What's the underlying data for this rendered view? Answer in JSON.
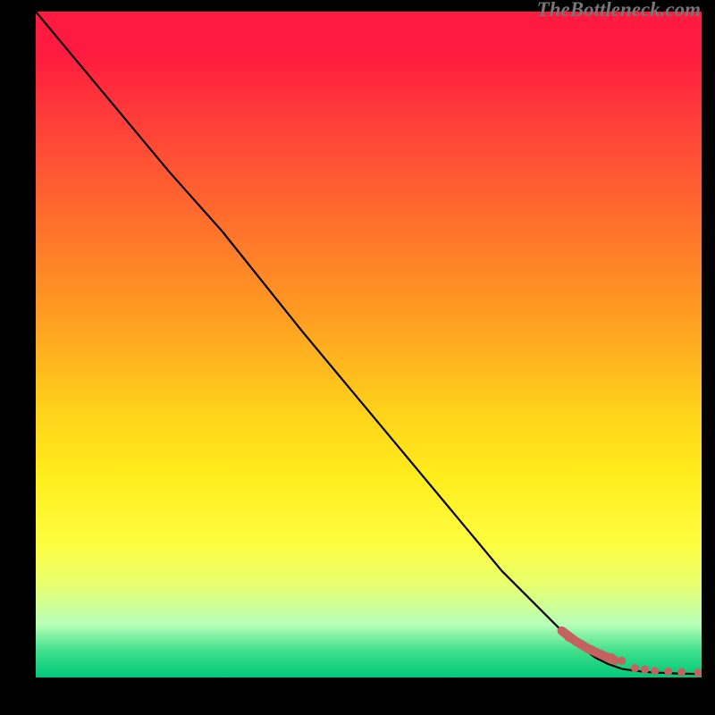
{
  "watermark": "TheBottleneck.com",
  "chart_data": {
    "type": "line",
    "title": "",
    "xlabel": "",
    "ylabel": "",
    "xlim": [
      0,
      100
    ],
    "ylim": [
      0,
      100
    ],
    "series": [
      {
        "name": "curve",
        "x": [
          0,
          10,
          20,
          28,
          40,
          55,
          70,
          80,
          84,
          86,
          88,
          90,
          92,
          94,
          96,
          98,
          100
        ],
        "y": [
          100,
          88,
          76,
          67,
          52,
          34,
          16,
          6,
          3,
          2,
          1.3,
          1,
          0.8,
          0.7,
          0.6,
          0.55,
          0.5
        ]
      }
    ],
    "scatter": {
      "name": "points-near-bottom",
      "color": "#c5625f",
      "x": [
        80,
        82,
        83.5,
        85,
        86.5,
        88,
        90,
        91.5,
        93,
        95,
        97,
        99.5
      ],
      "y": [
        6,
        5,
        4.2,
        3.5,
        3,
        2.5,
        1.4,
        1.2,
        1.0,
        0.9,
        0.8,
        0.7
      ]
    }
  }
}
